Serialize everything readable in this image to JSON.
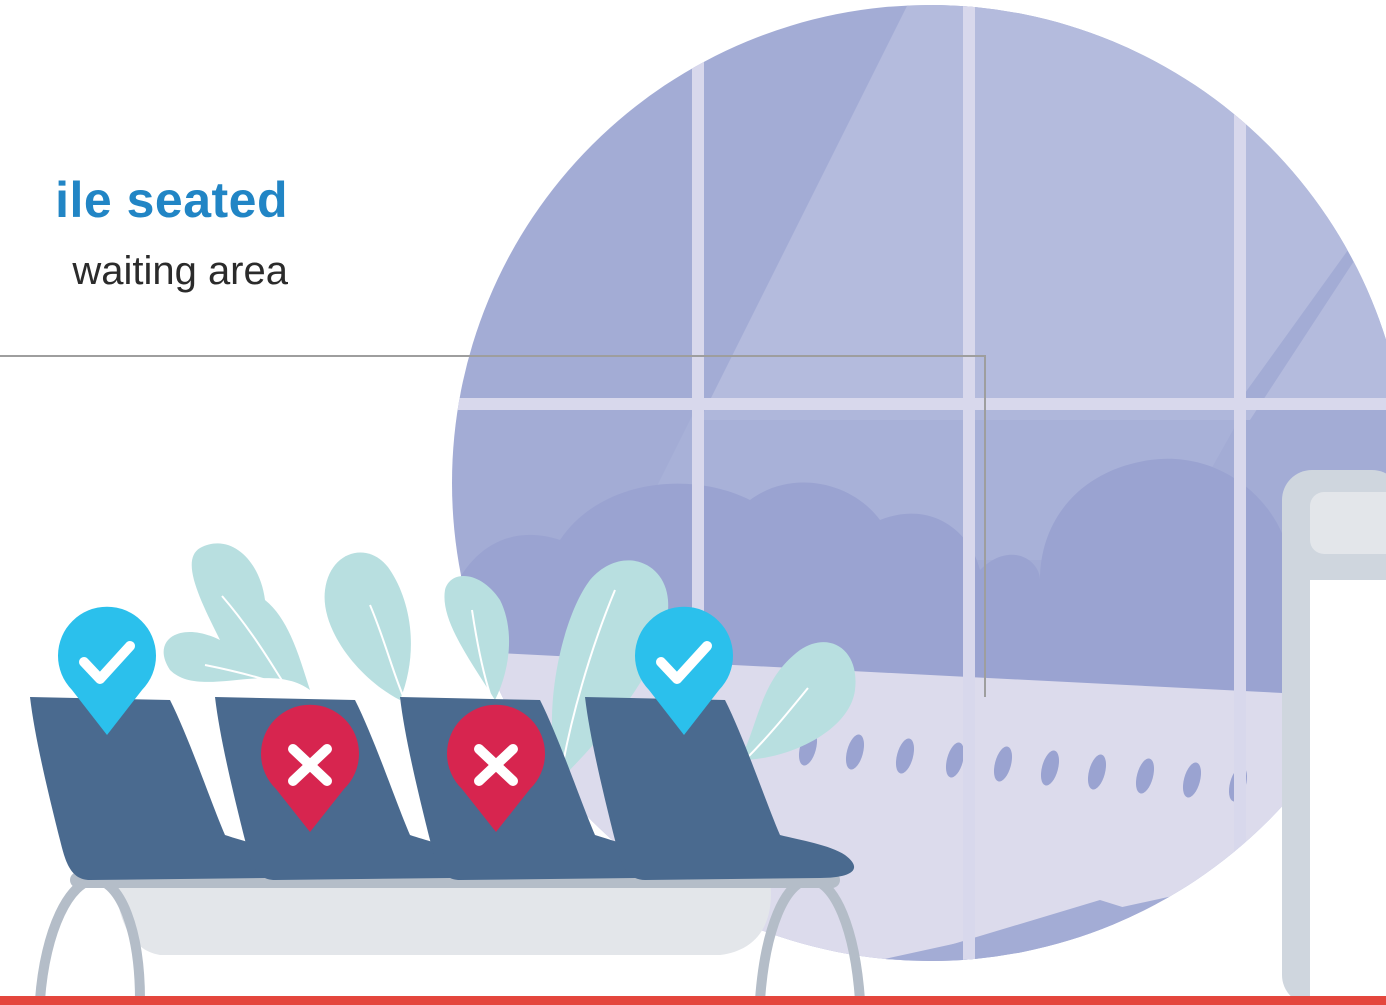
{
  "heading": {
    "title": "ile seated",
    "subtitle": "waiting area"
  },
  "colors": {
    "title": "#2185c5",
    "subtitle": "#2b2b2b",
    "window_light": "#b4bbdd",
    "window_dark": "#a3acd5",
    "window_frame": "#d8d8ec",
    "fuselage": "#dcdbec",
    "porthole": "#9aa3d1",
    "seat": "#4a6a8f",
    "bench_base": "#e3e6ea",
    "bench_frame": "#b4bdc8",
    "leaf": "#b8dfe0",
    "allowed_marker": "#2bc0ec",
    "blocked_marker": "#d7254f",
    "floor_line": "#e4463d",
    "sign_post": "#cfd6de"
  },
  "seats": [
    {
      "status": "allowed",
      "icon": "check-icon"
    },
    {
      "status": "blocked",
      "icon": "x-icon"
    },
    {
      "status": "blocked",
      "icon": "x-icon"
    },
    {
      "status": "allowed",
      "icon": "check-icon"
    }
  ]
}
